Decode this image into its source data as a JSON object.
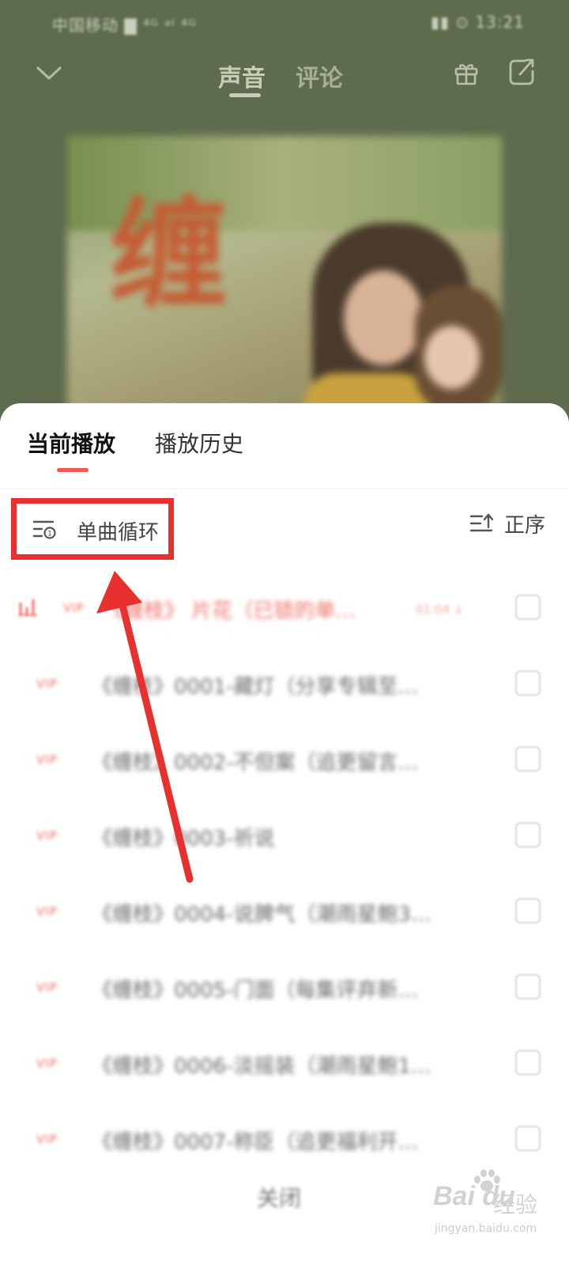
{
  "status_bar": {
    "left": "中国移动 ▇ ⁴ᴳ ᵃᴵ ⁴ᴳ",
    "right": "▮▮ ⊙ 13:21"
  },
  "top_nav": {
    "tabs": [
      {
        "label": "声音",
        "active": true
      },
      {
        "label": "评论",
        "active": false
      }
    ]
  },
  "cover": {
    "title_glyph": "缠"
  },
  "sheet": {
    "tabs": [
      {
        "label": "当前播放",
        "active": true
      },
      {
        "label": "播放历史",
        "active": false
      }
    ],
    "play_mode": {
      "label": "单曲循环",
      "icon": "single-loop-icon"
    },
    "sort": {
      "label": "正序",
      "icon": "sort-ascending-icon"
    },
    "tracks": [
      {
        "tag": "VIP",
        "title": "《缠枝》 片花（已锁的单…",
        "duration": "01:04 ↓",
        "playing": true
      },
      {
        "tag": "VIP",
        "title": "《缠枝》0001-藏灯（分享专辑至…",
        "playing": false
      },
      {
        "tag": "VIP",
        "title": "《缠枝》0002-不但案（追更留言…",
        "playing": false
      },
      {
        "tag": "VIP",
        "title": "《缠枝》0003-祈说",
        "playing": false
      },
      {
        "tag": "VIP",
        "title": "《缠枝》0004-说脾气（潮雨星鲍3…",
        "playing": false
      },
      {
        "tag": "VIP",
        "title": "《缠枝》0005-门面（每集评弃新…",
        "playing": false
      },
      {
        "tag": "VIP",
        "title": "《缠枝》0006-淡摇装（潮雨星鲍1…",
        "playing": false
      },
      {
        "tag": "VIP",
        "title": "《缠枝》0007-称臣（追更福利开…",
        "playing": false
      }
    ],
    "close_label": "关闭"
  },
  "annotation": {
    "color": "#e8312e"
  },
  "watermark": {
    "brand": "Bai du",
    "brand_cn": "经验",
    "url": "jingyan.baidu.com"
  }
}
